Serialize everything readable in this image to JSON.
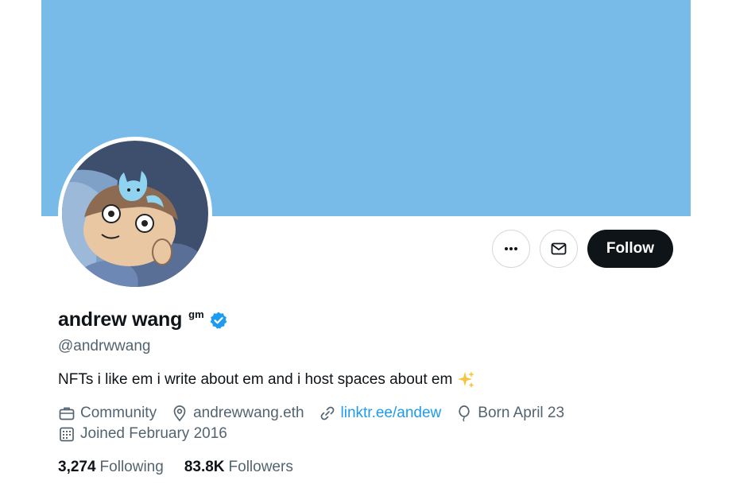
{
  "profile": {
    "display_name": "andrew wang",
    "name_suffix": "gm",
    "handle": "@andrwwang",
    "bio": "NFTs i like em i write about em and i host spaces about em",
    "verified": true
  },
  "meta": {
    "category": "Community",
    "location": "andrewwang.eth",
    "website": "linktr.ee/andew",
    "birthday": "Born April 23",
    "joined": "Joined February 2016"
  },
  "stats": {
    "following_count": "3,274",
    "following_label": "Following",
    "followers_count": "83.8K",
    "followers_label": "Followers"
  },
  "actions": {
    "follow_label": "Follow"
  },
  "icons": {
    "more": "more-icon",
    "message": "mail-icon",
    "verified": "verified-badge-icon",
    "sparkle": "sparkles-emoji",
    "category": "briefcase-icon",
    "location": "location-pin-icon",
    "website": "link-icon",
    "birthday": "balloon-icon",
    "joined": "calendar-icon"
  },
  "colors": {
    "banner": "#78bbe8",
    "accent": "#1d9bf0",
    "follow_button": "#0f1419",
    "muted_text": "#536471"
  }
}
